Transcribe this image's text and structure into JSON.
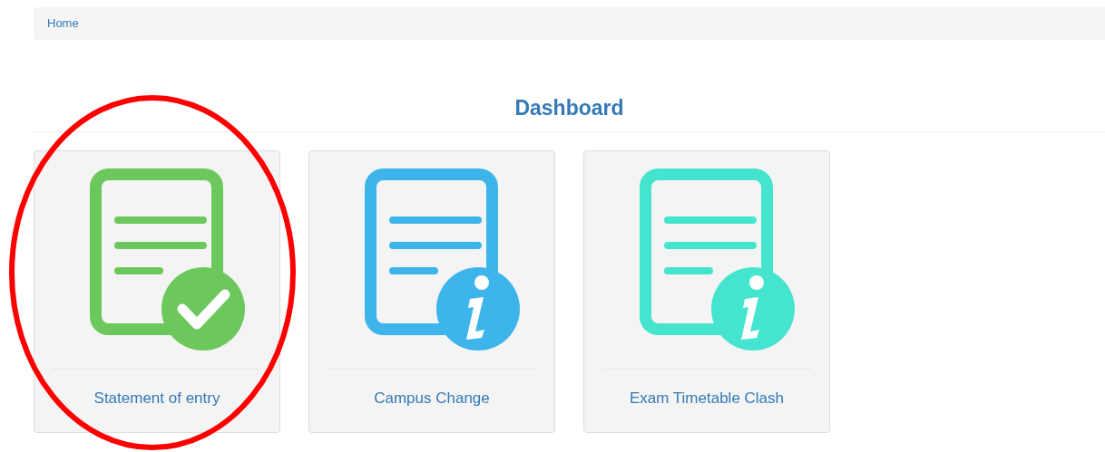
{
  "breadcrumb": [
    "Home"
  ],
  "title": "Dashboard",
  "cards": [
    {
      "label": "Statement of entry",
      "kind": "check",
      "color": "#6cc85c"
    },
    {
      "label": "Campus Change",
      "kind": "info",
      "color": "#3db5ea"
    },
    {
      "label": "Exam Timetable Clash",
      "kind": "info",
      "color": "#45e4cf"
    }
  ]
}
